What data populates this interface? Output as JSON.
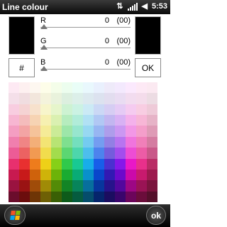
{
  "title_bar": {
    "title": "Line colour",
    "time": "5:53"
  },
  "channels": [
    {
      "label": "R",
      "value": "0",
      "hex": "(00)"
    },
    {
      "label": "G",
      "value": "0",
      "hex": "(00)"
    },
    {
      "label": "B",
      "value": "0",
      "hex": "(00)"
    }
  ],
  "buttons": {
    "hash_label": "#",
    "ok_label": "OK",
    "softkey_ok": "ok"
  },
  "colors": {
    "current": "#000000",
    "new": "#000000"
  },
  "palette": [
    [
      "#fde9f3",
      "#fdf0f0",
      "#fdf7f0",
      "#fdfde9",
      "#f4fde9",
      "#ecfdee",
      "#e9fdf7",
      "#e9f8fd",
      "#e9f0fd",
      "#eeeaf9",
      "#f3e9fd",
      "#fbe9fd",
      "#fde9f5",
      "#fbe9f1"
    ],
    [
      "#f4dfe9",
      "#f0dde0",
      "#f2e6dc",
      "#f4f3dc",
      "#e9f2dc",
      "#dcefdf",
      "#dcefe9",
      "#dce9ef",
      "#dce2ef",
      "#e2ddef",
      "#e9dcf2",
      "#f2dcef",
      "#f4dceb",
      "#ecdce3"
    ],
    [
      "#f8cde0",
      "#f5d3d3",
      "#f7e1cc",
      "#f7f5cb",
      "#e6f5cb",
      "#cdf2d2",
      "#cbf2e3",
      "#cbeaf5",
      "#cbd8f5",
      "#d6cdf3",
      "#e5cbf5",
      "#f5cbf0",
      "#f8cde2",
      "#eecad8"
    ],
    [
      "#f7b6d2",
      "#f4bcbc",
      "#f6d3b3",
      "#f6f0b1",
      "#daf0b1",
      "#b6ecbe",
      "#b1ecd9",
      "#b1e1f4",
      "#b1c8f4",
      "#c2b6f0",
      "#d8b1f4",
      "#f4b1eb",
      "#f7b6d6",
      "#e6b3c7"
    ],
    [
      "#f49ec2",
      "#f3a4a4",
      "#f5c39a",
      "#f5eb97",
      "#cbeb97",
      "#9de6a9",
      "#97e6ce",
      "#97d8f2",
      "#97b6f2",
      "#ae9deb",
      "#cb97f2",
      "#f297e6",
      "#f49eca",
      "#de9bb6"
    ],
    [
      "#f07fae",
      "#f08585",
      "#f3af78",
      "#f3e474",
      "#b8e474",
      "#7fdf8f",
      "#74dfbe",
      "#74cbf0",
      "#749df0",
      "#927fe4",
      "#b874f0",
      "#f074dd",
      "#f07fb9",
      "#d47ca1"
    ],
    [
      "#ec5c96",
      "#ec6262",
      "#f19a52",
      "#f1dc4d",
      "#a3dc4d",
      "#5cd672",
      "#4dd6ac",
      "#4dbeed",
      "#4d83ed",
      "#745cdc",
      "#a34ded",
      "#ed4dd4",
      "#ec5ca6",
      "#c95889"
    ],
    [
      "#e8306e",
      "#e83030",
      "#ee7c1c",
      "#eed018",
      "#86d018",
      "#30c94b",
      "#18c993",
      "#18ade9",
      "#185ee9",
      "#4a30d0",
      "#8618e9",
      "#e918c7",
      "#e8308b",
      "#b92d66"
    ],
    [
      "#c81a50",
      "#c81a1a",
      "#cf620c",
      "#cfb309",
      "#6cb309",
      "#1aab31",
      "#09ab76",
      "#0990cb",
      "#0946cb",
      "#3219b3",
      "#6c09cb",
      "#cb09aa",
      "#c81a6e",
      "#9d1a4e"
    ],
    [
      "#9a1340",
      "#9a1313",
      "#a04c09",
      "#a08b07",
      "#538b07",
      "#138425",
      "#07845b",
      "#076f9d",
      "#07369d",
      "#27138b",
      "#53079d",
      "#9d0784",
      "#9a1355",
      "#7a143d"
    ],
    [
      "#6b0d2c",
      "#6b0d0d",
      "#6e3506",
      "#6e6005",
      "#3a6005",
      "#0d5b1a",
      "#055b3f",
      "#054d6c",
      "#05256c",
      "#1b0d60",
      "#3a056c",
      "#6c055b",
      "#6b0d3b",
      "#54102b"
    ]
  ]
}
